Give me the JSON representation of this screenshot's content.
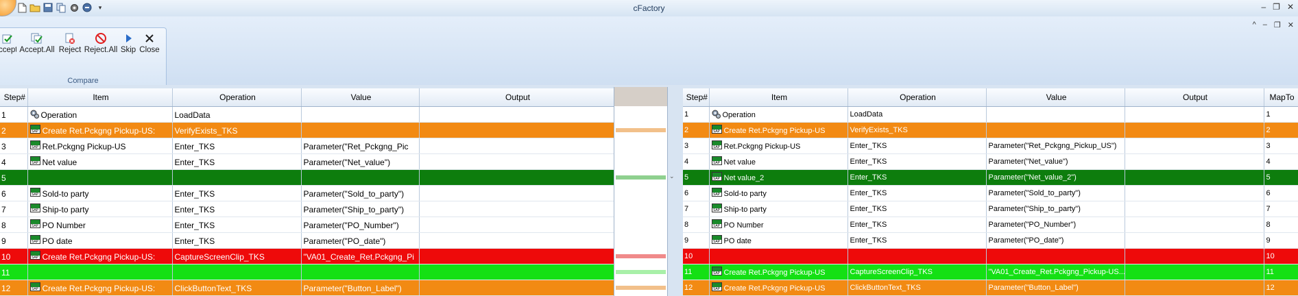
{
  "window": {
    "title": "cFactory",
    "controls": [
      "–",
      "❐",
      "✕"
    ],
    "inner_controls": [
      "^",
      "–",
      "❐",
      "✕"
    ]
  },
  "quick_access": [
    "new-file-icon",
    "open-folder-icon",
    "save-icon",
    "copy-icon",
    "settings-gear-icon",
    "help-icon"
  ],
  "ribbon": {
    "group_label": "Compare",
    "buttons": [
      {
        "label": "ccept",
        "icon": "accept-icon"
      },
      {
        "label": "Accept.All",
        "icon": "accept-all-icon"
      },
      {
        "label": "Reject",
        "icon": "reject-icon"
      },
      {
        "label": "Reject.All",
        "icon": "reject-all-icon"
      },
      {
        "label": "Skip",
        "icon": "skip-icon"
      },
      {
        "label": "Close",
        "icon": "close-icon"
      }
    ]
  },
  "colors": {
    "orange": "#f28a13",
    "dark_green": "#0d7d0d",
    "red": "#ee0a0a",
    "light_green": "#14e014"
  },
  "left_grid": {
    "headers": [
      "Step#",
      "Item",
      "Operation",
      "Value",
      "Output"
    ],
    "rows": [
      {
        "status": "normal",
        "icon": "operation-gear-icon",
        "cells": [
          "1",
          "Operation",
          "LoadData",
          "",
          ""
        ]
      },
      {
        "status": "orange",
        "icon": "sap-icon",
        "cells": [
          "2",
          "Create Ret.Pckgng Pickup-US:",
          "VerifyExists_TKS",
          "",
          ""
        ]
      },
      {
        "status": "normal",
        "icon": "sap-icon",
        "cells": [
          "3",
          "Ret.Pckgng Pickup-US",
          "Enter_TKS",
          "Parameter(\"Ret_Pckgng_Pic",
          ""
        ]
      },
      {
        "status": "normal",
        "icon": "sap-icon",
        "cells": [
          "4",
          "Net value",
          "Enter_TKS",
          "Parameter(\"Net_value\")",
          ""
        ]
      },
      {
        "status": "dkgreen",
        "icon": "",
        "cells": [
          "5",
          "",
          "",
          "",
          ""
        ]
      },
      {
        "status": "normal",
        "icon": "sap-icon",
        "cells": [
          "6",
          "Sold-to party",
          "Enter_TKS",
          "Parameter(\"Sold_to_party\")",
          ""
        ]
      },
      {
        "status": "normal",
        "icon": "sap-icon",
        "cells": [
          "7",
          "Ship-to party",
          "Enter_TKS",
          "Parameter(\"Ship_to_party\")",
          ""
        ]
      },
      {
        "status": "normal",
        "icon": "sap-icon",
        "cells": [
          "8",
          "PO Number",
          "Enter_TKS",
          "Parameter(\"PO_Number\")",
          ""
        ]
      },
      {
        "status": "normal",
        "icon": "sap-icon",
        "cells": [
          "9",
          "PO date",
          "Enter_TKS",
          "Parameter(\"PO_date\")",
          ""
        ]
      },
      {
        "status": "red",
        "icon": "sap-icon",
        "cells": [
          "10",
          "Create Ret.Pckgng Pickup-US:",
          "CaptureScreenClip_TKS",
          "\"VA01_Create_Ret.Pckgng_Pi",
          ""
        ]
      },
      {
        "status": "ltgreen",
        "icon": "",
        "cells": [
          "11",
          "",
          "",
          "",
          ""
        ]
      },
      {
        "status": "orange",
        "icon": "sap-icon",
        "cells": [
          "12",
          "Create Ret.Pckgng Pickup-US:",
          "ClickButtonText_TKS",
          "Parameter(\"Button_Label\")",
          ""
        ]
      }
    ]
  },
  "right_grid": {
    "headers": [
      "Step#",
      "Item",
      "Operation",
      "Value",
      "Output",
      "MapTo"
    ],
    "rows": [
      {
        "status": "normal",
        "icon": "operation-gear-icon",
        "cells": [
          "1",
          "Operation",
          "LoadData",
          "",
          "",
          "1"
        ]
      },
      {
        "status": "orange",
        "icon": "sap-icon",
        "cells": [
          "2",
          "Create Ret.Pckgng Pickup-US",
          "VerifyExists_TKS",
          "",
          "",
          "2"
        ]
      },
      {
        "status": "normal",
        "icon": "sap-icon",
        "cells": [
          "3",
          "Ret.Pckgng Pickup-US",
          "Enter_TKS",
          "Parameter(\"Ret_Pckgng_Pickup_US\")",
          "",
          "3"
        ]
      },
      {
        "status": "normal",
        "icon": "sap-icon",
        "cells": [
          "4",
          "Net value",
          "Enter_TKS",
          "Parameter(\"Net_value\")",
          "",
          "4"
        ]
      },
      {
        "status": "dkgreen",
        "icon": "sap-icon",
        "cells": [
          "5",
          "Net value_2",
          "Enter_TKS",
          "Parameter(\"Net_value_2\")",
          "",
          "5"
        ]
      },
      {
        "status": "normal",
        "icon": "sap-icon",
        "cells": [
          "6",
          "Sold-to party",
          "Enter_TKS",
          "Parameter(\"Sold_to_party\")",
          "",
          "6"
        ]
      },
      {
        "status": "normal",
        "icon": "sap-icon",
        "cells": [
          "7",
          "Ship-to party",
          "Enter_TKS",
          "Parameter(\"Ship_to_party\")",
          "",
          "7"
        ]
      },
      {
        "status": "normal",
        "icon": "sap-icon",
        "cells": [
          "8",
          "PO Number",
          "Enter_TKS",
          "Parameter(\"PO_Number\")",
          "",
          "8"
        ]
      },
      {
        "status": "normal",
        "icon": "sap-icon",
        "cells": [
          "9",
          "PO date",
          "Enter_TKS",
          "Parameter(\"PO_date\")",
          "",
          "9"
        ]
      },
      {
        "status": "red",
        "icon": "",
        "cells": [
          "10",
          "",
          "",
          "",
          "",
          "10"
        ]
      },
      {
        "status": "ltgreen",
        "icon": "sap-icon",
        "cells": [
          "11",
          "Create Ret.Pckgng Pickup-US",
          "CaptureScreenClip_TKS",
          "\"VA01_Create_Ret.Pckgng_Pickup-US...",
          "",
          "11"
        ]
      },
      {
        "status": "orange",
        "icon": "sap-icon",
        "cells": [
          "12",
          "Create Ret.Pckgng Pickup-US",
          "ClickButtonText_TKS",
          "Parameter(\"Button_Label\")",
          "",
          "12"
        ]
      }
    ]
  },
  "connector_links": [
    {
      "row": 2,
      "color": "#f2c08a"
    },
    {
      "row": 5,
      "color": "#8fd08f"
    },
    {
      "row": 10,
      "color": "#f08a8a"
    },
    {
      "row": 11,
      "color": "#a8f0a8"
    },
    {
      "row": 12,
      "color": "#f2c08a"
    }
  ]
}
